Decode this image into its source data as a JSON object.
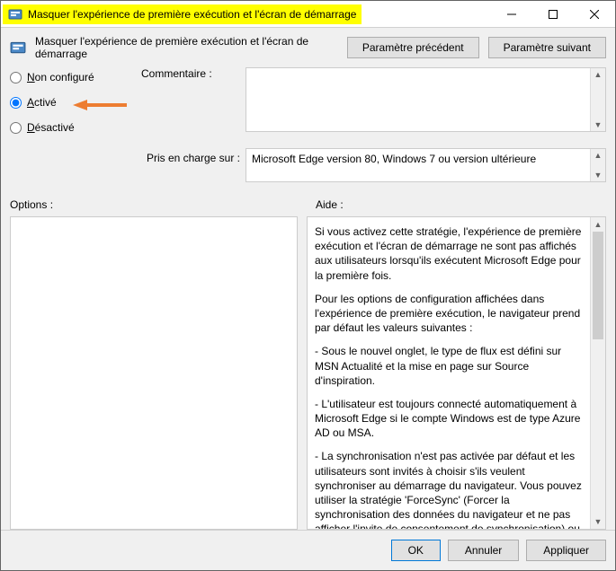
{
  "window": {
    "title": "Masquer l'expérience de première exécution et l'écran de démarrage"
  },
  "header": {
    "title": "Masquer l'expérience de première exécution et l'écran de démarrage",
    "prev_label": "Paramètre précédent",
    "next_label": "Paramètre suivant"
  },
  "state": {
    "not_configured_label": "Non configuré",
    "enabled_label": "Activé",
    "disabled_label": "Désactivé",
    "selected": "enabled"
  },
  "labels": {
    "comment": "Commentaire :",
    "supported": "Pris en charge sur :",
    "options": "Options :",
    "help": "Aide :"
  },
  "supported_on": "Microsoft Edge version 80, Windows 7 ou version ultérieure",
  "help": {
    "p1": "Si vous activez cette stratégie, l'expérience de première exécution et l'écran de démarrage ne sont pas affichés aux utilisateurs lorsqu'ils exécutent Microsoft Edge pour la première fois.",
    "p2": "Pour les options de configuration affichées dans l'expérience de première exécution, le navigateur prend par défaut les valeurs suivantes :",
    "p3": "- Sous le nouvel onglet, le type de flux est défini sur MSN Actualité et la mise en page sur Source d'inspiration.",
    "p4": "- L'utilisateur est toujours connecté automatiquement à Microsoft Edge si le compte Windows est de type Azure AD ou MSA.",
    "p5": "- La synchronisation n'est pas activée par défaut et les utilisateurs sont invités à choisir s'ils veulent synchroniser au démarrage du navigateur. Vous pouvez utiliser la stratégie 'ForceSync' (Forcer la synchronisation des données du navigateur et ne pas afficher l'invite de consentement de synchronisation) ou 'SyncDisabled' (Désactiver la synchronisation des données à l'aide des services"
  },
  "footer": {
    "ok": "OK",
    "cancel": "Annuler",
    "apply": "Appliquer"
  }
}
